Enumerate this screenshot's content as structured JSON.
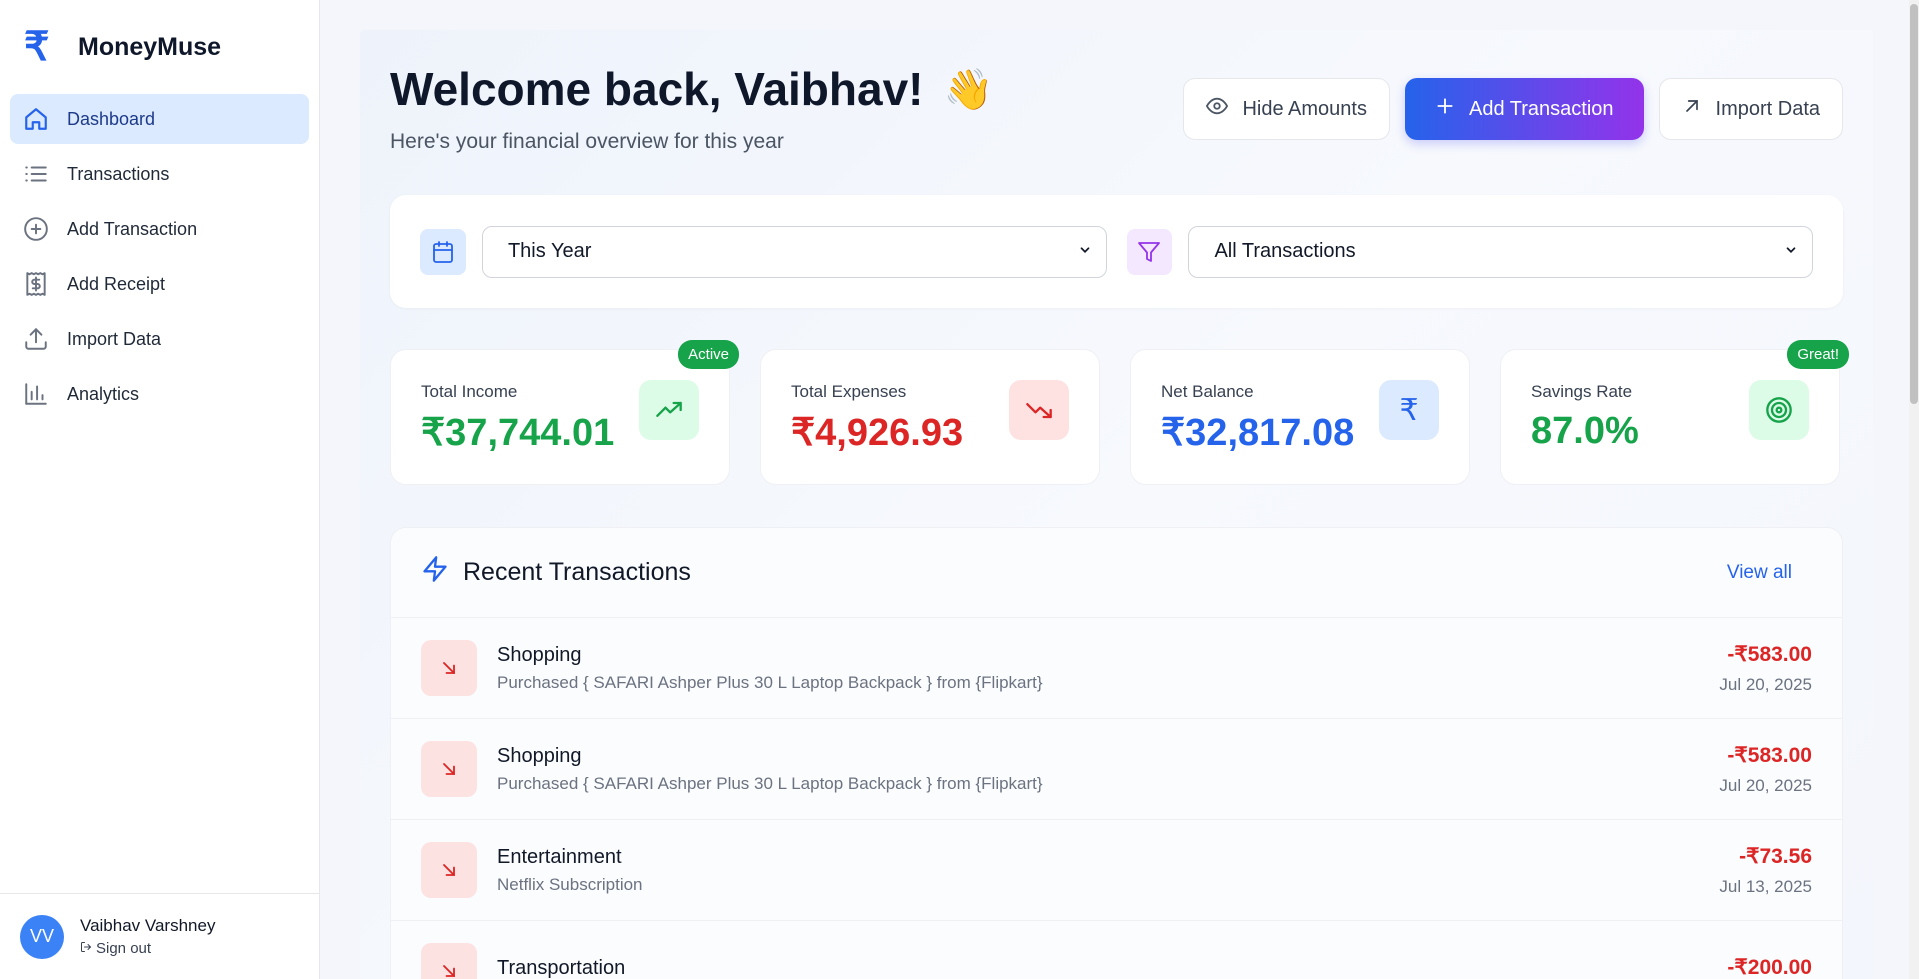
{
  "brand": {
    "logo": "₹",
    "name": "MoneyMuse"
  },
  "sidebar": {
    "items": [
      {
        "label": "Dashboard",
        "icon": "home-icon",
        "active": true
      },
      {
        "label": "Transactions",
        "icon": "list-icon"
      },
      {
        "label": "Add Transaction",
        "icon": "plus-circle-icon"
      },
      {
        "label": "Add Receipt",
        "icon": "receipt-icon"
      },
      {
        "label": "Import Data",
        "icon": "upload-icon"
      },
      {
        "label": "Analytics",
        "icon": "bar-chart-icon"
      }
    ]
  },
  "user": {
    "initials": "VV",
    "name": "Vaibhav Varshney",
    "signout": "Sign out"
  },
  "header": {
    "title": "Welcome back, Vaibhav!",
    "emoji": "👋",
    "subtitle": "Here's your financial overview for this year"
  },
  "actions": {
    "hide": "Hide Amounts",
    "add": "Add Transaction",
    "import": "Import Data"
  },
  "filters": {
    "period": "This Year",
    "type": "All Transactions"
  },
  "stats": [
    {
      "label": "Total Income",
      "value": "₹37,744.01",
      "color": "#16a34a",
      "icon_bg": "#dcfce7",
      "icon": "trending-up-icon",
      "badge": "Active"
    },
    {
      "label": "Total Expenses",
      "value": "₹4,926.93",
      "color": "#dc2626",
      "icon_bg": "#fee2e2",
      "icon": "trending-down-icon",
      "badge": ""
    },
    {
      "label": "Net Balance",
      "value": "₹32,817.08",
      "color": "#2563eb",
      "icon_bg": "#dbeafe",
      "icon": "rupee-icon",
      "badge": ""
    },
    {
      "label": "Savings Rate",
      "value": "87.0%",
      "color": "#16a34a",
      "icon_bg": "#dcfce7",
      "icon": "target-icon",
      "badge": "Great!"
    }
  ],
  "recent": {
    "title": "Recent Transactions",
    "view_all": "View all",
    "rows": [
      {
        "category": "Shopping",
        "description": "Purchased { SAFARI Ashper Plus 30 L Laptop Backpack } from {Flipkart}",
        "amount": "-₹583.00",
        "date": "Jul 20, 2025"
      },
      {
        "category": "Shopping",
        "description": "Purchased { SAFARI Ashper Plus 30 L Laptop Backpack } from {Flipkart}",
        "amount": "-₹583.00",
        "date": "Jul 20, 2025"
      },
      {
        "category": "Entertainment",
        "description": "Netflix Subscription",
        "amount": "-₹73.56",
        "date": "Jul 13, 2025"
      },
      {
        "category": "Transportation",
        "description": "",
        "amount": "-₹200.00",
        "date": ""
      }
    ]
  }
}
